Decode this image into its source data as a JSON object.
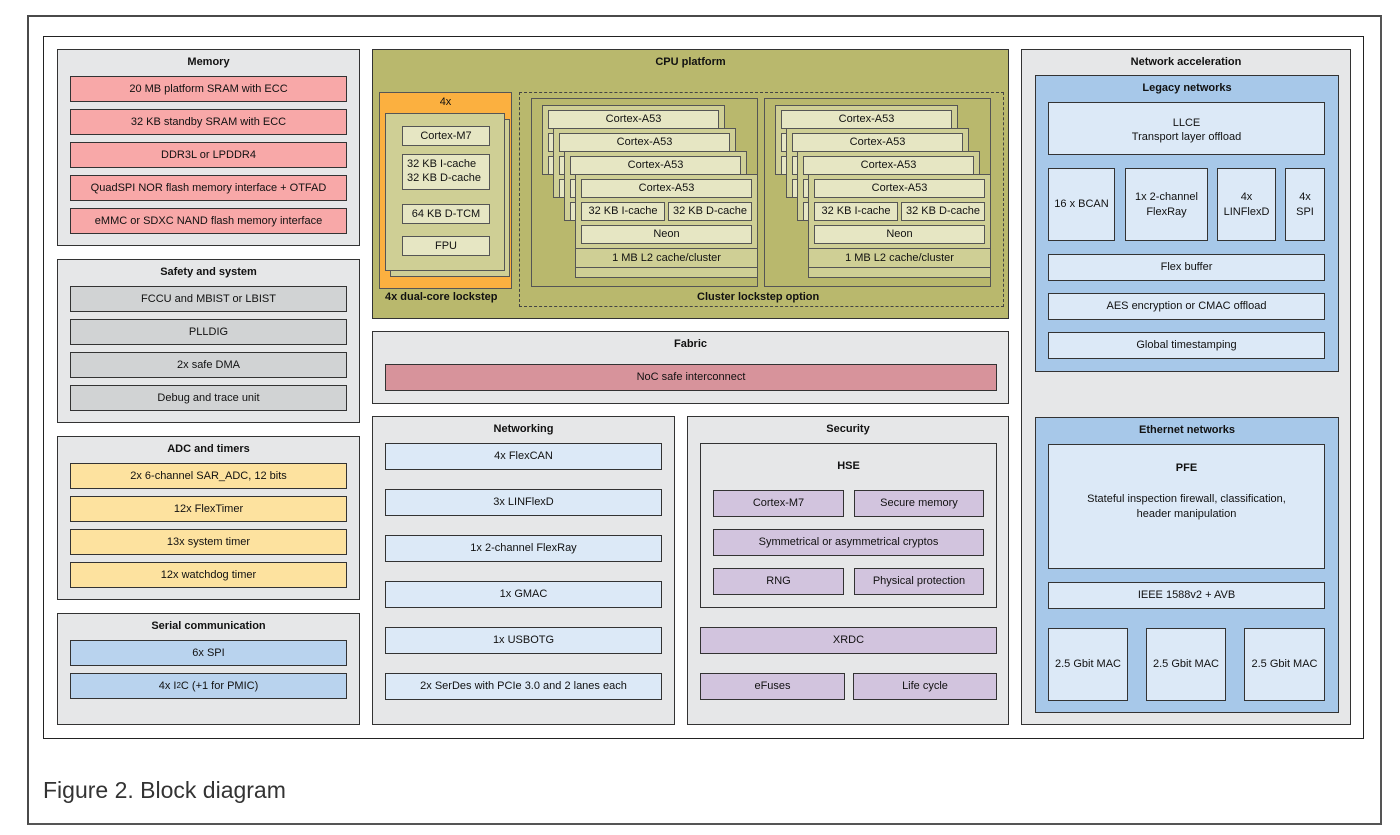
{
  "caption": "Figure 2.  Block diagram",
  "colors": {
    "memory": "#f8a8a8",
    "safety": "#d1d3d4",
    "adc": "#fde29f",
    "serial": "#b9d3ee",
    "networking": "#dce9f7",
    "security": "#d2c4de",
    "fabric": "#d7939b",
    "cpu_platform": "#b9b86d",
    "lockstep": "#fbb040",
    "network_acceleration": "#a7c8e9",
    "group_background": "#e6e7e8"
  },
  "memory": {
    "title": "Memory",
    "items": [
      "20 MB platform SRAM with ECC",
      "32 KB standby SRAM with ECC",
      "DDR3L or LPDDR4",
      "QuadSPI NOR flash memory interface + OTFAD",
      "eMMC or SDXC NAND flash memory interface"
    ]
  },
  "safety": {
    "title": "Safety and system",
    "items": [
      "FCCU and MBIST or LBIST",
      "PLLDIG",
      "2x safe DMA",
      "Debug and trace unit"
    ]
  },
  "adc": {
    "title": "ADC and timers",
    "items": [
      "2x 6-channel SAR_ADC, 12 bits",
      "12x FlexTimer",
      "13x system timer",
      "12x watchdog timer"
    ]
  },
  "serial": {
    "title": "Serial communication",
    "items": [
      "6x SPI"
    ],
    "i2c_prefix": "4x I",
    "i2c_sup": "2",
    "i2c_suffix": "C (+1 for PMIC)"
  },
  "cpu": {
    "title": "CPU platform",
    "lockstep": {
      "count": "4x",
      "label": "4x dual-core lockstep",
      "items": [
        "Cortex-M7",
        "32 KB I-cache",
        "32 KB D-cache",
        "64 KB D-TCM",
        "FPU"
      ]
    },
    "cluster_option_label": "Cluster lockstep option",
    "cluster": {
      "core": "Cortex-A53",
      "icache": "32 KB I-cache",
      "dcache": "32 KB D-cache",
      "neon": "Neon",
      "l2": "1 MB L2 cache/cluster"
    }
  },
  "fabric": {
    "title": "Fabric",
    "item": "NoC safe interconnect"
  },
  "networking": {
    "title": "Networking",
    "items": [
      "4x FlexCAN",
      "3x LINFlexD",
      "1x 2-channel FlexRay",
      "1x GMAC",
      "1x USBOTG",
      "2x SerDes with PCIe 3.0 and 2 lanes each"
    ]
  },
  "security": {
    "title": "Security",
    "hse_title": "HSE",
    "hse_items": [
      "Cortex-M7",
      "Secure memory",
      "Symmetrical or asymmetrical cryptos",
      "RNG",
      "Physical protection"
    ],
    "items": [
      "XRDC",
      "eFuses",
      "Life cycle"
    ]
  },
  "network_acceleration": {
    "title": "Network acceleration",
    "legacy": {
      "title": "Legacy networks",
      "llce_title": "LLCE",
      "llce_sub": "Transport layer offload",
      "bcan": "16 x BCAN",
      "flexray_1": "1x 2-channel",
      "flexray_2": "FlexRay",
      "linflexd_1": "4x",
      "linflexd_2": "LINFlexD",
      "spi_1": "4x",
      "spi_2": "SPI",
      "flex_buffer": "Flex buffer",
      "aes": "AES encryption or CMAC offload",
      "timestamp": "Global timestamping"
    },
    "ethernet": {
      "title": "Ethernet networks",
      "pfe_title": "PFE",
      "pfe_desc_1": "Stateful inspection firewall, classification,",
      "pfe_desc_2": "header manipulation",
      "ieee": "IEEE 1588v2 + AVB",
      "macs": [
        "2.5 Gbit MAC",
        "2.5 Gbit MAC",
        "2.5 Gbit MAC"
      ]
    }
  }
}
